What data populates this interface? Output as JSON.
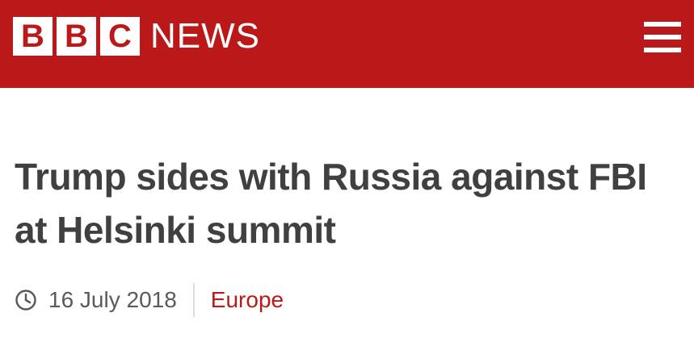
{
  "header": {
    "logo_letters": [
      "B",
      "B",
      "C"
    ],
    "logo_word": "NEWS",
    "menu_icon": "hamburger-menu-icon",
    "background_color": "#bb1919"
  },
  "article": {
    "headline": "Trump sides with Russia against FBI at Helsinki summit",
    "date_icon": "clock-icon",
    "date": "16 July 2018",
    "section": "Europe",
    "section_color": "#bb1919"
  }
}
